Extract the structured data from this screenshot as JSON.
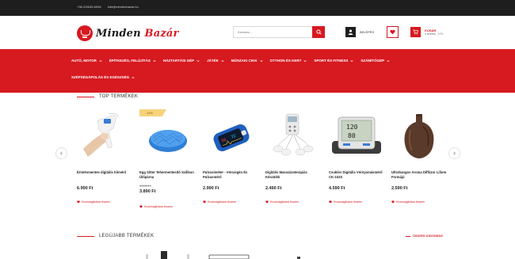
{
  "topbar": {
    "phone": "+36-20/649-6946",
    "email": "info@mindenbazar.hu"
  },
  "header": {
    "logo_word1": "Minden",
    "logo_word2": "Bazár",
    "search_placeholder": "Keresés...",
    "login_label": "BELÉPÉS",
    "cart_title": "KOSÁR",
    "cart_subtitle": "0 termék - 0 Ft"
  },
  "nav": {
    "items": [
      "AUTÓ, MOTOR",
      "ÉPÍTKEZÉS, FELÚJÍTÁS",
      "HÁZTARTÁSI GÉP",
      "JÁTÉK",
      "MŰSZAKI CIKK",
      "OTTHON ÉS KERT",
      "SPORT ÉS FITNESS",
      "SZÁMÍTÓGÉP",
      "SZÉPSÉGÁPOLÁS ÉS EGÉSZSÉG"
    ]
  },
  "top_products": {
    "title": "TOP TERMÉKEK",
    "wishlist_label": "Kívánságlistára teszem",
    "items": [
      {
        "name": "Érintésmentes digitális hőmérő",
        "price": "6.990 Ft"
      },
      {
        "name": "Egg Sitter Tehermentesítő Szilikon Ülőpárna",
        "badge": "-11%",
        "old_price": "4.390 Ft",
        "price": "3.890 Ft"
      },
      {
        "name": "Pulzoximéter - Véroxigén És Pulzusmérő",
        "price": "2.990 Ft"
      },
      {
        "name": "Digitális Masszázsterápiás Készülék",
        "price": "2.490 Ft"
      },
      {
        "name": "Csuklós Digitális Vérnyomásmérő CK-102S",
        "price": "4.590 Ft"
      },
      {
        "name": "Ultrahangos Aroma Diffúzor Liliom Formájú",
        "price": "2.590 Ft"
      }
    ]
  },
  "new_products": {
    "title": "LEGÚJABB TERMÉKEK",
    "all_label": "ÖSSZES ÚJDONSÁG"
  },
  "colors": {
    "brand_red": "#d71920",
    "dark": "#1e1e1e",
    "badge_yellow": "#f6d37a"
  }
}
